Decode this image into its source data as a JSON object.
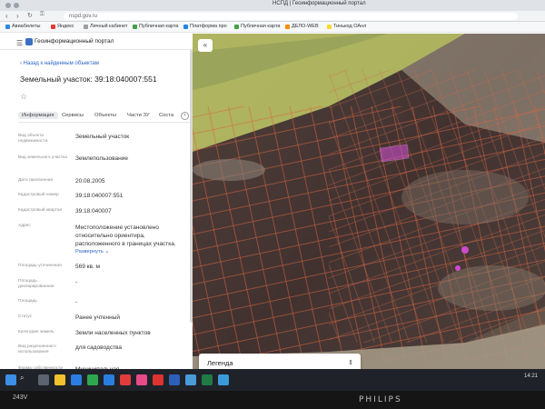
{
  "browser": {
    "url": "nspd.gov.ru",
    "window_title": "НСПД | Геоинформационный портал",
    "bookmarks": [
      {
        "label": "Авиабилеты",
        "color": "#2b8be6"
      },
      {
        "label": "Яндекс",
        "color": "#e53935"
      },
      {
        "label": "Личный кабинет",
        "color": "#9e9e9e"
      },
      {
        "label": "Публичная карта",
        "color": "#43a047"
      },
      {
        "label": "Платформа про",
        "color": "#1e88e5"
      },
      {
        "label": "Публичная карта",
        "color": "#43a047"
      },
      {
        "label": "ДЕЛО-WEB",
        "color": "#fb8c00"
      },
      {
        "label": "Тинькод ОАнл",
        "color": "#fdd835"
      }
    ]
  },
  "app": {
    "title": "Геоинформационный портал"
  },
  "panel": {
    "back_link": "Назад к найденным объектам",
    "object_title": "Земельный участок: 39:18:040007:551",
    "tabs": [
      {
        "label": "Информация",
        "active": true
      },
      {
        "label": "Сервисы",
        "active": false
      },
      {
        "label": "Объекты",
        "active": false
      },
      {
        "label": "Части ЗУ",
        "active": false
      },
      {
        "label": "Соста",
        "active": false
      }
    ],
    "fields": [
      {
        "label": "Вид объекта недвижимости",
        "value": "Земельный участок"
      },
      {
        "label": "Вид земельного участка",
        "value": "Землепользование"
      },
      {
        "label": "Дата присвоения",
        "value": "20.08.2005"
      },
      {
        "label": "Кадастровый номер",
        "value": "39:18:040007:551"
      },
      {
        "label": "Кадастровый квартал",
        "value": "39:18:040007"
      },
      {
        "label": "Адрес",
        "value": "Местоположение установлено относительно ориентира, расположенного в границах участка.",
        "more": "Развернуть"
      },
      {
        "label": "Площадь уточненная",
        "value": "569 кв. м"
      },
      {
        "label": "Площадь декларированная",
        "value": "-"
      },
      {
        "label": "Площадь",
        "value": "-"
      },
      {
        "label": "Статус",
        "value": "Ранее учтенный"
      },
      {
        "label": "Категория земель",
        "value": "Земли населенных пунктов"
      },
      {
        "label": "Вид разрешенного использования",
        "value": "для садоводства"
      },
      {
        "label": "Форма собственности",
        "value": "Муниципальная"
      }
    ]
  },
  "map": {
    "legend_label": "Легенда",
    "highlight_color": "#c84fc8",
    "boundary_color": "#e0603a",
    "zone_color": "#b9c25a"
  },
  "taskbar": {
    "time": "14:21",
    "date": "243V"
  },
  "monitor": {
    "brand": "PHILIPS",
    "model": "243V"
  }
}
